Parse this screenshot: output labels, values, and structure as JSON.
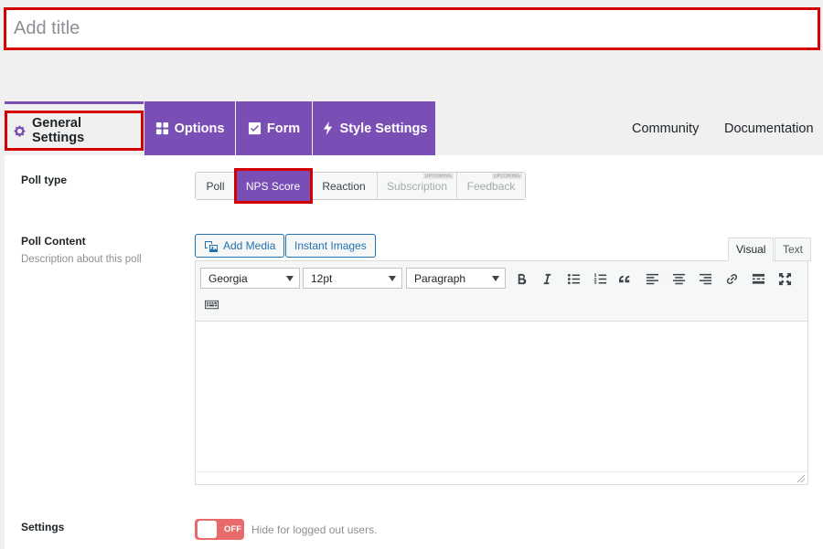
{
  "title_field": {
    "placeholder": "Add title",
    "value": ""
  },
  "tabs": {
    "general": "General Settings",
    "options": "Options",
    "form": "Form",
    "style": "Style Settings",
    "community": "Community",
    "documentation": "Documentation"
  },
  "poll_type": {
    "label": "Poll type",
    "options": [
      "Poll",
      "NPS Score",
      "Reaction",
      "Subscription",
      "Feedback"
    ],
    "selected": "NPS Score",
    "upcoming_badge": "UPCOMING"
  },
  "poll_content": {
    "label": "Poll Content",
    "description": "Description about this poll",
    "add_media": "Add Media",
    "instant_images": "Instant Images",
    "visual_tab": "Visual",
    "text_tab": "Text",
    "font_family": "Georgia",
    "font_size": "12pt",
    "format": "Paragraph"
  },
  "settings": {
    "label": "Settings",
    "toggle_state": "OFF",
    "toggle_desc": "Hide for logged out users."
  },
  "colors": {
    "brand_purple": "#7a4fb5",
    "highlight_red": "#d40000",
    "toggle_off": "#e76b6b",
    "link_blue": "#2271b1"
  }
}
